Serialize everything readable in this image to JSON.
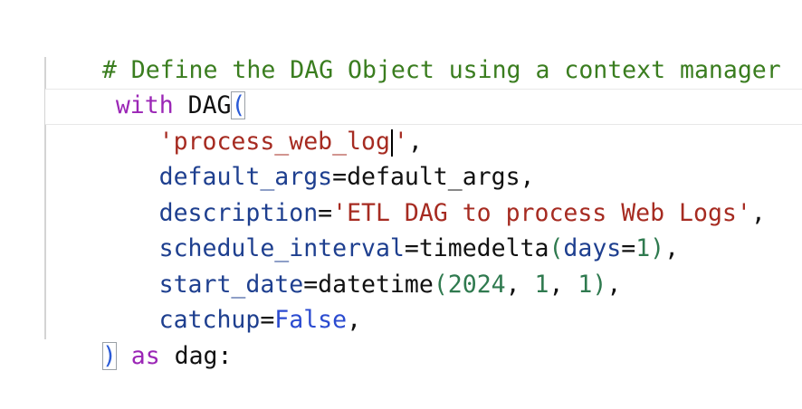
{
  "code": {
    "lines": [
      {
        "tokens": [
          {
            "text": "# Define the DAG Object using a context manager",
            "class": "cm"
          }
        ]
      },
      {
        "tokens": [
          {
            "text": "with",
            "class": "kw"
          },
          {
            "text": " DAG",
            "class": "nm"
          },
          {
            "text": "(",
            "class": "paren-blue"
          }
        ]
      },
      {
        "tokens": [
          {
            "text": "    'process_web_log",
            "class": "str"
          },
          {
            "text": "'",
            "class": "str"
          },
          {
            "text": ",",
            "class": "op"
          }
        ]
      },
      {
        "tokens": [
          {
            "text": "    default_args",
            "class": "par"
          },
          {
            "text": "=",
            "class": "op"
          },
          {
            "text": "default_args",
            "class": "nm"
          },
          {
            "text": ",",
            "class": "op"
          }
        ]
      },
      {
        "tokens": [
          {
            "text": "    description",
            "class": "par"
          },
          {
            "text": "=",
            "class": "op"
          },
          {
            "text": "'ETL DAG to process Web Logs'",
            "class": "str"
          },
          {
            "text": ",",
            "class": "op"
          }
        ]
      },
      {
        "tokens": [
          {
            "text": "    schedule_interval",
            "class": "par"
          },
          {
            "text": "=",
            "class": "op"
          },
          {
            "text": "timedelta",
            "class": "nm"
          },
          {
            "text": "(",
            "class": "paren-green"
          },
          {
            "text": "days",
            "class": "par"
          },
          {
            "text": "=",
            "class": "op"
          },
          {
            "text": "1",
            "class": "num"
          },
          {
            "text": ")",
            "class": "paren-green"
          },
          {
            "text": ",",
            "class": "op"
          }
        ]
      },
      {
        "tokens": [
          {
            "text": "    start_date",
            "class": "par"
          },
          {
            "text": "=",
            "class": "op"
          },
          {
            "text": "datetime",
            "class": "nm"
          },
          {
            "text": "(",
            "class": "paren-green"
          },
          {
            "text": "2024",
            "class": "num"
          },
          {
            "text": ", ",
            "class": "op"
          },
          {
            "text": "1",
            "class": "num"
          },
          {
            "text": ", ",
            "class": "op"
          },
          {
            "text": "1",
            "class": "num"
          },
          {
            "text": ")",
            "class": "paren-green"
          },
          {
            "text": ",",
            "class": "op"
          }
        ]
      },
      {
        "tokens": [
          {
            "text": "    catchup",
            "class": "par"
          },
          {
            "text": "=",
            "class": "op"
          },
          {
            "text": "False",
            "class": "bi"
          },
          {
            "text": ",",
            "class": "op"
          }
        ]
      },
      {
        "tokens": [
          {
            "text": ")",
            "class": "paren-blue"
          },
          {
            "text": " as",
            "class": "kw"
          },
          {
            "text": " dag:",
            "class": "nm"
          }
        ]
      }
    ]
  }
}
